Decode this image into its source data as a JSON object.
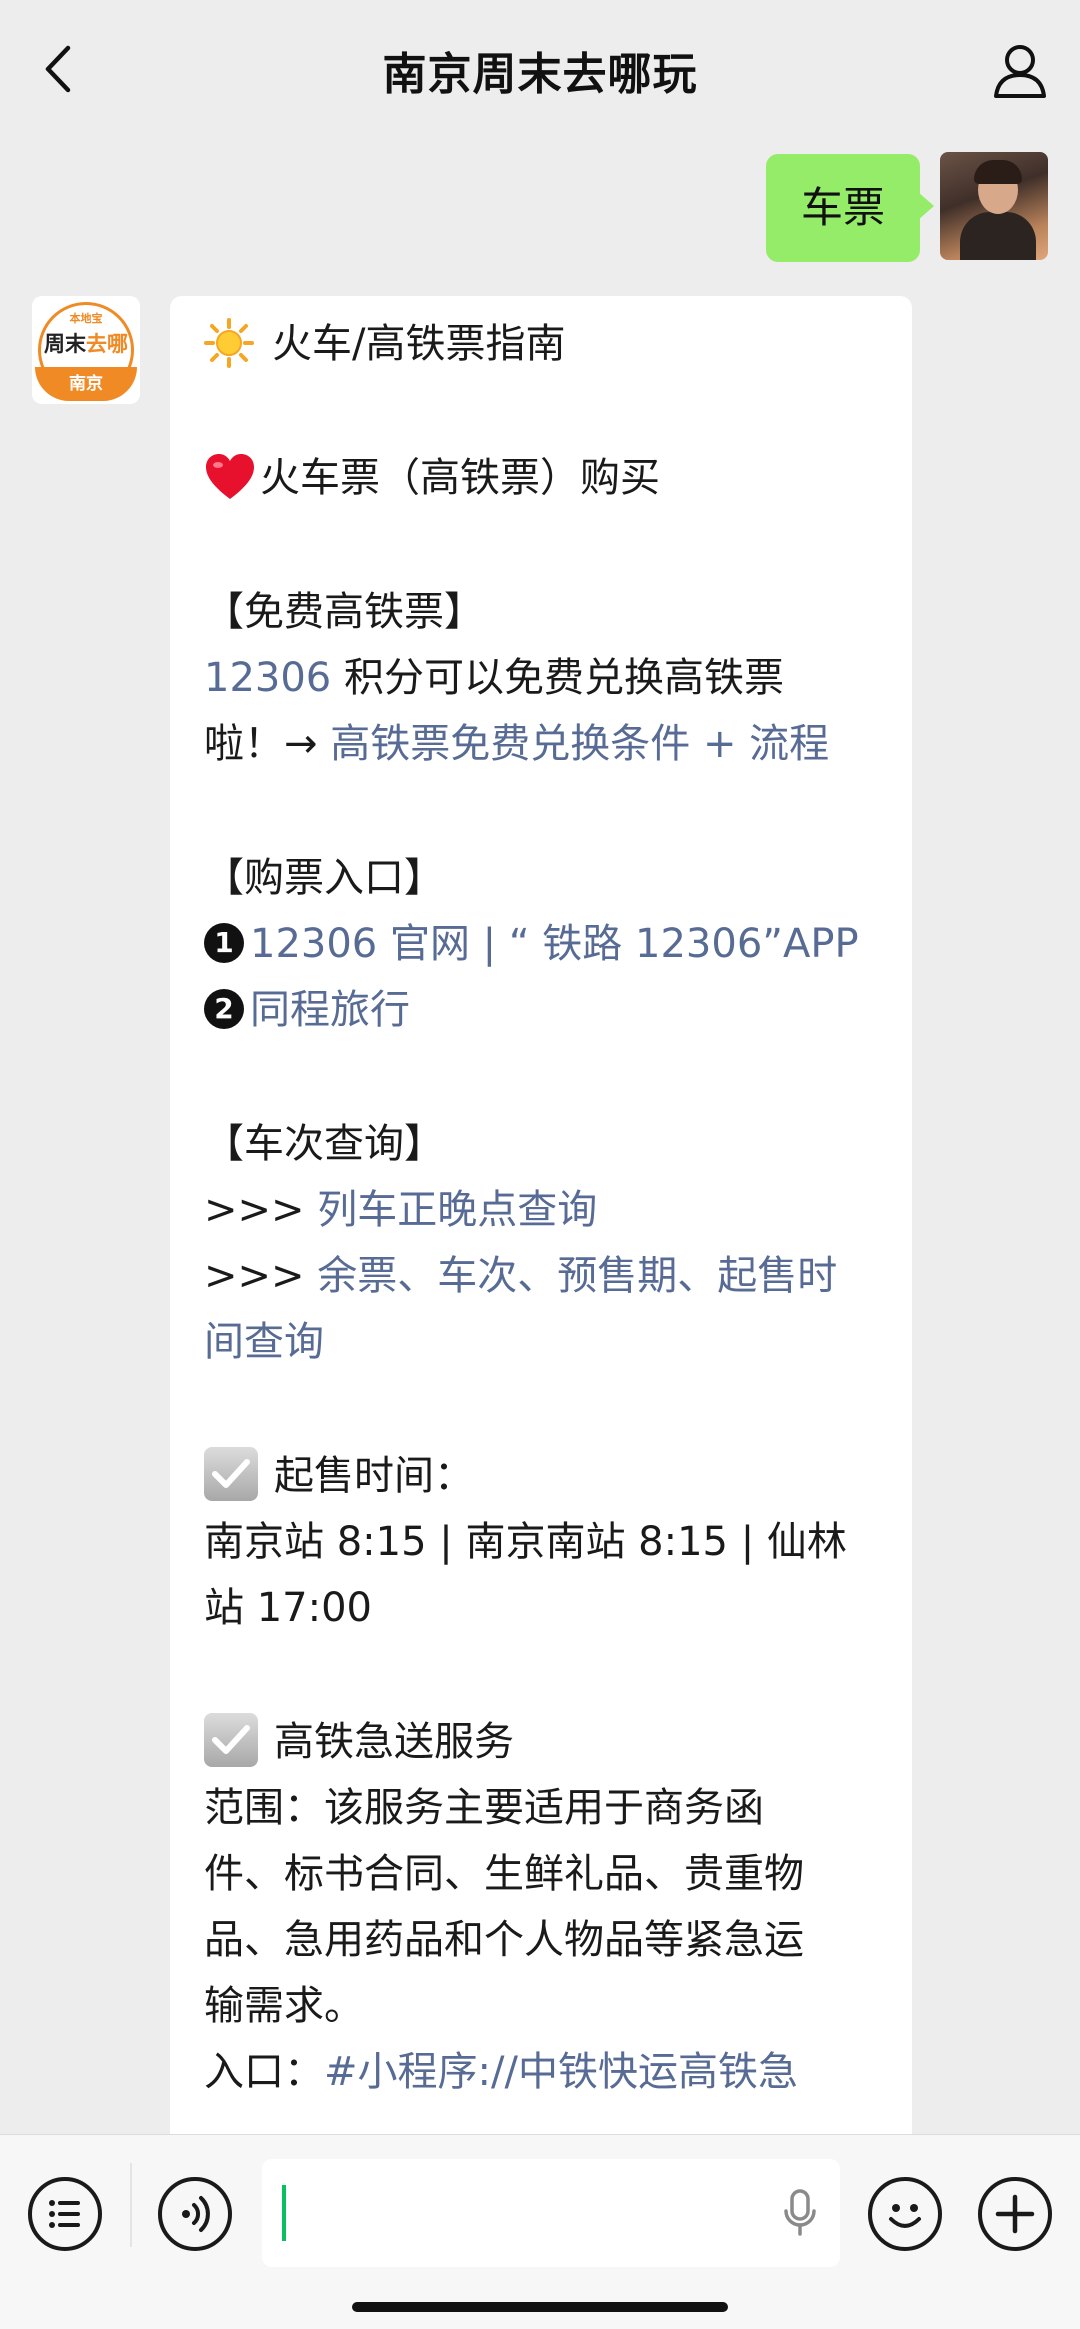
{
  "header": {
    "title": "南京周末去哪玩"
  },
  "outgoing": {
    "text": "车票"
  },
  "bot_avatar": {
    "top_text": "本地宝",
    "line1_a": "周末",
    "line1_b": "去哪",
    "bottom_text": "南京"
  },
  "message": {
    "heading": "火车/高铁票指南",
    "sub_heading": "火车票（高铁票）购买",
    "free_title": "【免费高铁票】",
    "free_link1": "12306",
    "free_text1": " 积分可以免费兑换高铁票",
    "free_text2": "啦！→ ",
    "free_link2": "高铁票免费兑换条件 + 流程",
    "buy_title": "【购票入口】",
    "buy_num1": "1",
    "buy_link1": "12306 官网 | “ 铁路 12306”APP",
    "buy_num2": "2",
    "buy_link2": "同程旅行",
    "query_title": "【车次查询】",
    "query_prefix": ">>> ",
    "query_link1": "列车正晚点查询",
    "query_link2a": "余票、车次、预售期、起售时",
    "query_link2b": "间查询",
    "sale_title": "起售时间：",
    "sale_line1": "南京站 8:15 | 南京南站 8:15 | 仙林",
    "sale_line2": "站 17:00",
    "express_title": "高铁急送服务",
    "express_line1": "范围：该服务主要适用于商务函",
    "express_line2": "件、标书合同、生鲜礼品、贵重物",
    "express_line3": "品、急用药品和个人物品等紧急运",
    "express_line4": "输需求。",
    "entry_label": "入口：",
    "entry_link": "#小程序://中铁快运高铁急"
  },
  "colors": {
    "background": "#ededed",
    "outgoing_bubble": "#95ec69",
    "link": "#576b95",
    "caret": "#07c160",
    "brand_orange": "#f08a24"
  },
  "icons": {
    "back": "chevron-left-icon",
    "profile": "person-icon",
    "menu": "list-icon",
    "voice": "voice-icon",
    "mic": "mic-icon",
    "emoji": "emoji-icon",
    "plus": "plus-icon"
  }
}
